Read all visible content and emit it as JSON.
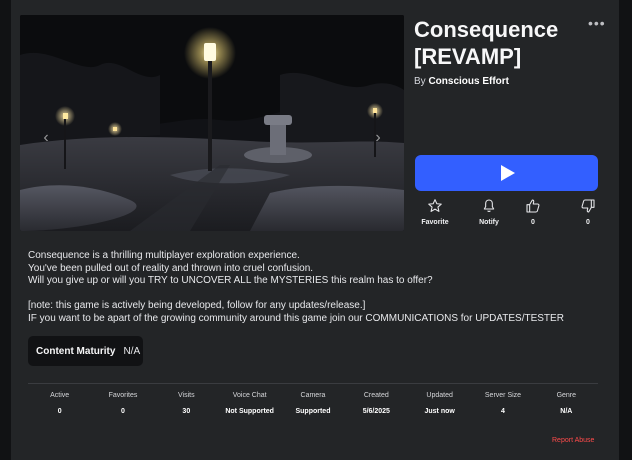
{
  "game": {
    "title": "Consequence [REVAMP]",
    "by_prefix": "By",
    "creator": "Conscious Effort"
  },
  "icons": {
    "more": "ellipsis-icon",
    "play": "play-icon",
    "favorite": "star-icon",
    "notify": "bell-icon",
    "upvote": "thumbs-up-icon",
    "downvote": "thumbs-down-icon",
    "prev": "chevron-left-icon",
    "next": "chevron-right-icon"
  },
  "actions": {
    "favorite_label": "Favorite",
    "notify_label": "Notify",
    "upvotes": "0",
    "downvotes": "0"
  },
  "description": {
    "line1": "Consequence is a thrilling multiplayer exploration experience.",
    "line2": "You've been pulled out of reality and thrown into cruel confusion.",
    "line3": "Will you give up or will you TRY to UNCOVER ALL the MYSTERIES this realm has to offer?",
    "line4": "[note: this game is actively being developed, follow for any updates/release.]",
    "line5": "IF you want to be apart of the growing community around this game join our COMMUNICATIONS for UPDATES/TESTER"
  },
  "maturity": {
    "label": "Content Maturity",
    "value": "N/A"
  },
  "stats": [
    {
      "header": "Active",
      "value": "0"
    },
    {
      "header": "Favorites",
      "value": "0"
    },
    {
      "header": "Visits",
      "value": "30"
    },
    {
      "header": "Voice Chat",
      "value": "Not Supported"
    },
    {
      "header": "Camera",
      "value": "Supported"
    },
    {
      "header": "Created",
      "value": "5/6/2025"
    },
    {
      "header": "Updated",
      "value": "Just now"
    },
    {
      "header": "Server Size",
      "value": "4"
    },
    {
      "header": "Genre",
      "value": "N/A"
    }
  ],
  "report_label": "Report Abuse",
  "colors": {
    "play_button": "#335fff",
    "panel": "#232527",
    "report": "#ff4b4b"
  }
}
